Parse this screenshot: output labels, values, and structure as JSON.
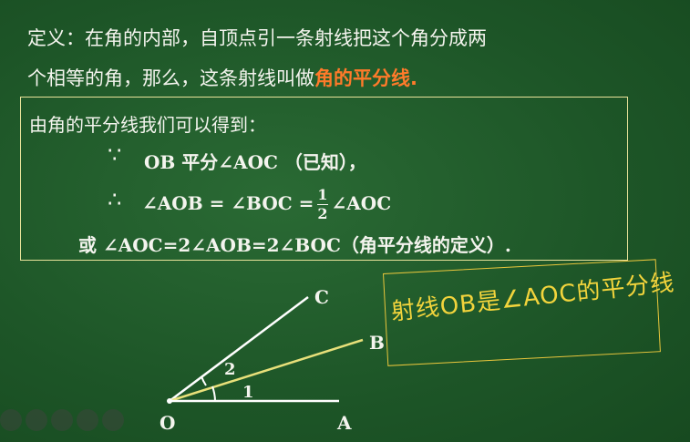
{
  "definition": {
    "line1": "定义：在角的内部，自顶点引一条射线把这个角分成两",
    "line2_prefix": "个相等的角，那么，这条射线叫做",
    "term": "角的平分线."
  },
  "box": {
    "intro": "由角的平分线我们可以得到：",
    "because_symbol": "∵",
    "because_text": "OB 平分∠AOC （已知），",
    "therefore_symbol": "∴",
    "therefore_text_a": "∠AOB = ∠BOC =",
    "frac_num": "1",
    "frac_den": "2",
    "therefore_text_b": "∠AOC",
    "or_line": "或 ∠AOC=2∠AOB=2∠BOC（角平分线的定义）."
  },
  "diagram": {
    "label_C": "C",
    "label_B": "B",
    "label_A": "A",
    "label_O": "O",
    "angle_1": "1",
    "angle_2": "2",
    "colors": {
      "rays": "#ffffff",
      "bisector": "#e8e07a",
      "handwriting": "#f2d43c"
    }
  },
  "handwritten_note": "射线OB是∠AOC的平分线"
}
